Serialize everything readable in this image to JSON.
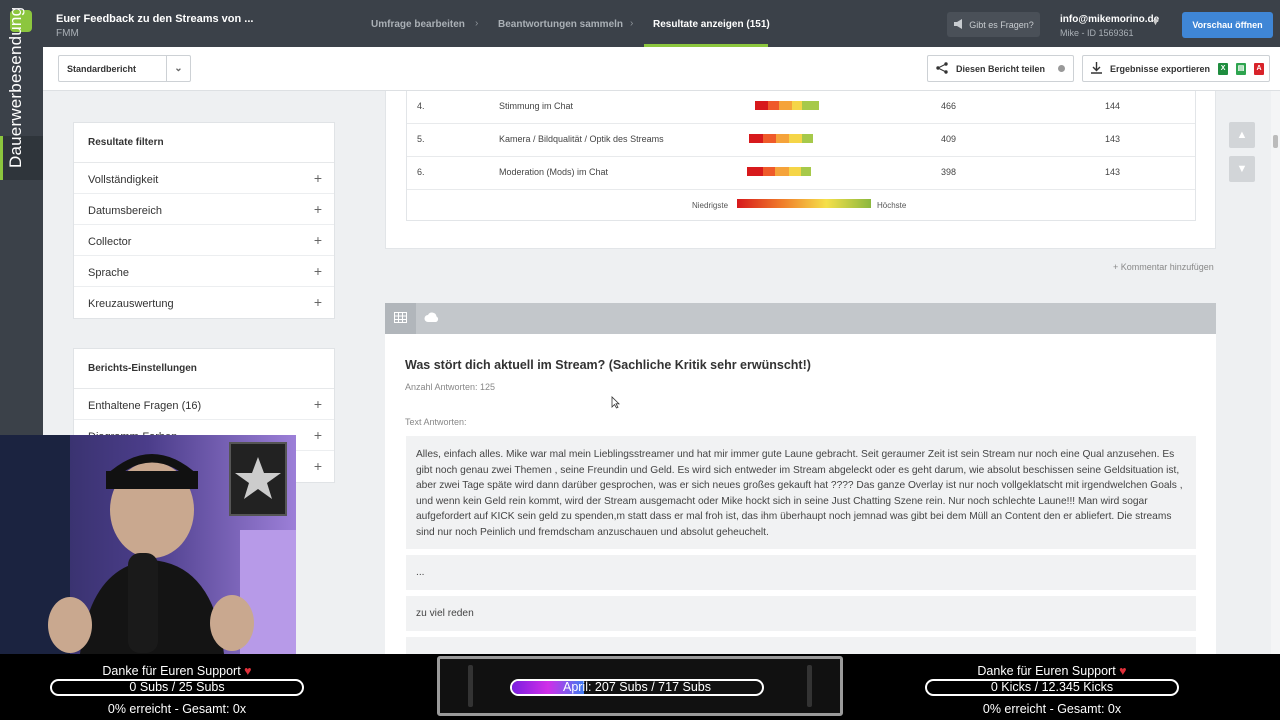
{
  "app": {
    "survey_title": "Euer Feedback zu den Streams von ...",
    "survey_subtitle": "FMM",
    "rail_label": "Dauerwerbesendung"
  },
  "steps": [
    {
      "label": "Umfrage bearbeiten",
      "active": false
    },
    {
      "label": "Beantwortungen sammeln",
      "active": false
    },
    {
      "label": "Resultate anzeigen (151)",
      "active": true
    }
  ],
  "header": {
    "help_label": "Gibt es Fragen?",
    "account_email": "info@mikemorino.de",
    "account_meta": "Mike - ID 1569361",
    "preview_label": "Vorschau öffnen"
  },
  "toolbar": {
    "report_select": "Standardbericht",
    "share_label": "Diesen Bericht teilen",
    "export_label": "Ergebnisse exportieren"
  },
  "filter_panel": {
    "title": "Resultate filtern",
    "items": [
      "Vollständigkeit",
      "Datumsbereich",
      "Collector",
      "Sprache",
      "Kreuzauswertung"
    ]
  },
  "settings_panel": {
    "title": "Berichts-Einstellungen",
    "items": [
      "Enthaltene Fragen (16)",
      "Diagramm-Farben"
    ]
  },
  "rating_table": {
    "rows": [
      {
        "rank": "4.",
        "label": "Stimmung im Chat",
        "score": "466",
        "count": "144"
      },
      {
        "rank": "5.",
        "label": "Kamera / Bildqualität / Optik des Streams",
        "score": "409",
        "count": "143"
      },
      {
        "rank": "6.",
        "label": "Moderation (Mods) im Chat",
        "score": "398",
        "count": "143"
      }
    ],
    "legend_low": "Niedrigste",
    "legend_high": "Höchste",
    "colors": [
      "#d7191c",
      "#ef5a2a",
      "#f5a33a",
      "#f5d547",
      "#a6c94a"
    ]
  },
  "add_comment": "+ Kommentar hinzufügen",
  "question": {
    "title": "Was stört dich aktuell im Stream? (Sachliche Kritik sehr erwünscht!)",
    "count": "Anzahl Antworten: 125",
    "text_label": "Text Antworten:",
    "answers": [
      "Alles, einfach alles. Mike war mal mein Lieblingsstreamer und hat mir immer gute Laune gebracht. Seit geraumer Zeit ist sein Stream nur noch eine Qual anzusehen. Es gibt noch genau zwei Themen , seine Freundin und Geld. Es wird sich entweder im Stream abgeleckt oder es geht darum, wie absolut beschissen seine Geldsituation ist, aber zwei Tage späte wird dann darüber gesprochen, was er sich neues großes gekauft hat ???? Das ganze Overlay ist nur noch vollgeklatscht mit irgendwelchen Goals , und wenn kein Geld rein kommt, wird der Stream ausgemacht oder Mike hockt sich in seine Just Chatting Szene rein. Nur noch schlechte Laune!!! Man wird sogar aufgefordert auf KICK sein geld zu spenden,m statt dass er mal froh ist, das ihm überhaupt noch jemnad was gibt bei dem Müll an Content den er abliefert. Die streams sind nur noch Peinlich und fremdscham anzuschauen und absolut geheuchelt.",
      "...",
      "zu viel reden"
    ]
  },
  "stream_overlay": {
    "left": {
      "title": "Danke für Euren Support",
      "bar": "0 Subs / 25 Subs",
      "progress": 0,
      "footer": "0% erreicht - Gesamt: 0x"
    },
    "center": {
      "bar": "April: 207 Subs / 717 Subs",
      "progress": 0.289
    },
    "right": {
      "title": "Danke für Euren Support",
      "bar": "0 Kicks / 12.345 Kicks",
      "progress": 0,
      "footer": "0% erreicht - Gesamt: 0x"
    },
    "heart": "♥"
  }
}
